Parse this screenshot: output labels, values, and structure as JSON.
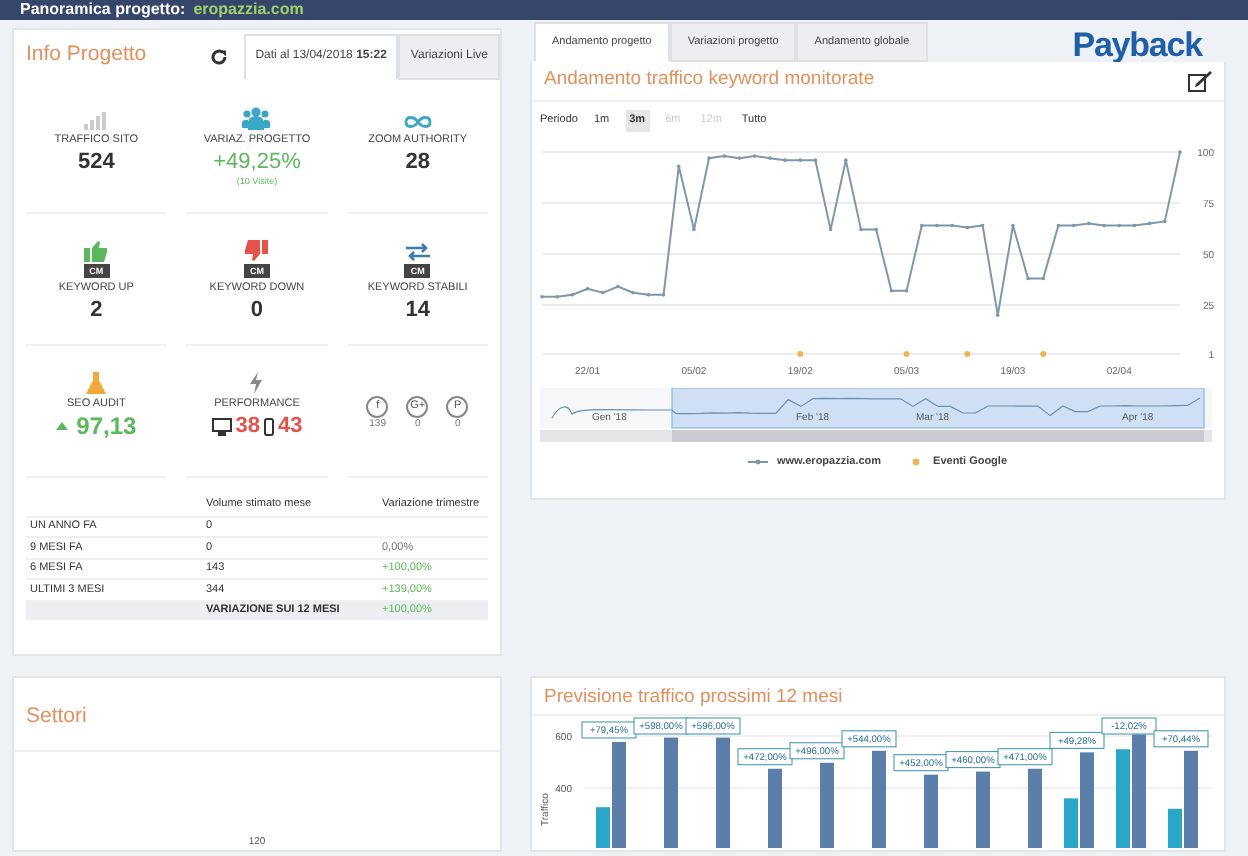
{
  "header": {
    "title": "Panoramica progetto:",
    "domain": "eropazzia.com"
  },
  "info_panel": {
    "title": "Info Progetto",
    "tabs": [
      {
        "label": "Dati al 13/04/2018 **15:22**",
        "selected": true
      },
      {
        "label": "Variazioni Live",
        "selected": false
      }
    ],
    "stats": [
      {
        "kind": "metric",
        "label": "TRAFFICO SITO",
        "value": "524"
      },
      {
        "kind": "metric",
        "label": "VARIAZ. PROGETTO",
        "value": "+49,25%",
        "note": "(10 Visite)",
        "positive": true
      },
      {
        "kind": "metric",
        "label": "ZOOM AUTHORITY",
        "value": "28"
      },
      {
        "kind": "metric",
        "badge": "CM",
        "label": "KEYWORD UP",
        "value": "2"
      },
      {
        "kind": "metric",
        "badge": "CM",
        "label": "KEYWORD DOWN",
        "value": "0"
      },
      {
        "kind": "metric",
        "badge": "CM",
        "label": "KEYWORD STABILI",
        "value": "14"
      },
      {
        "kind": "score",
        "label": "SEO AUDIT",
        "value": "97,13",
        "positive": true
      },
      {
        "kind": "performance",
        "label": "PERFORMANCE",
        "desktop": "38",
        "mobile": "43",
        "negative": true
      },
      {
        "kind": "social",
        "items": [
          {
            "glyph": "f",
            "count": "139"
          },
          {
            "glyph": "G+",
            "count": "0"
          },
          {
            "glyph": "P",
            "count": "0"
          }
        ]
      }
    ],
    "table": {
      "columns": [
        "Volume stimato mese",
        "Variazione trimestre"
      ],
      "rows": [
        {
          "label": "UN ANNO FA",
          "volume": "0"
        },
        {
          "label": "9 MESI FA",
          "volume": "0",
          "change": "0,00%",
          "positive": false
        },
        {
          "label": "6 MESI FA",
          "volume": "143",
          "change": "+100,00%",
          "positive": true
        },
        {
          "label": "ULTIMI 3 MESI",
          "volume": "344",
          "change": "+139,00%",
          "positive": true
        }
      ],
      "footer": {
        "label": "VARIAZIONE SUI 12 MESI",
        "change": "+100,00%",
        "positive": true
      }
    }
  },
  "sectors_card": {
    "title": "Settori",
    "tick": "120"
  },
  "right": {
    "tabs": [
      {
        "label": "Andamento progetto",
        "selected": true
      },
      {
        "label": "Variazioni progetto",
        "selected": false
      },
      {
        "label": "Andamento globale",
        "selected": false
      }
    ],
    "logo": "Payback",
    "traffic_card": {
      "title": "Andamento traffico keyword monitorate",
      "period_label": "Periodo",
      "periods": [
        {
          "label": "1m",
          "selected": false,
          "disabled": false
        },
        {
          "label": "3m",
          "selected": true,
          "disabled": false
        },
        {
          "label": "6m",
          "selected": false,
          "disabled": true
        },
        {
          "label": "12m",
          "selected": false,
          "disabled": true
        },
        {
          "label": "Tutto",
          "selected": false,
          "disabled": false
        }
      ],
      "chart_data": {
        "type": "line",
        "categories": [
          null,
          null,
          null,
          "22/01",
          null,
          null,
          null,
          null,
          null,
          null,
          "05/02",
          null,
          null,
          null,
          null,
          null,
          null,
          "19/02",
          null,
          null,
          null,
          null,
          null,
          null,
          "05/03",
          null,
          null,
          null,
          null,
          null,
          null,
          "19/03",
          null,
          null,
          null,
          null,
          null,
          null,
          "02/04",
          null,
          null,
          null,
          null
        ],
        "ylim": [
          1,
          100
        ],
        "yticks": [
          1,
          25,
          50,
          75,
          100
        ],
        "grid": true,
        "series": [
          {
            "name": "www.eropazzia.com",
            "color": "#7f97ab",
            "values": [
              29,
              29,
              30,
              33,
              31,
              34,
              31,
              30,
              30,
              93,
              62,
              97,
              98,
              97,
              98,
              97,
              96,
              96,
              96,
              62,
              96,
              62,
              62,
              32,
              32,
              64,
              64,
              64,
              63,
              64,
              20,
              64,
              38,
              38,
              64,
              64,
              65,
              64,
              64,
              64,
              65,
              66,
              100
            ]
          },
          {
            "name": "Eventi Google",
            "type": "scatter",
            "color": "#f0b454",
            "values": [
              null,
              null,
              null,
              null,
              null,
              null,
              null,
              null,
              null,
              null,
              null,
              null,
              null,
              null,
              null,
              null,
              null,
              1,
              null,
              null,
              null,
              null,
              null,
              null,
              1,
              null,
              null,
              null,
              1,
              null,
              null,
              null,
              null,
              1,
              null,
              null,
              null,
              null,
              null,
              null,
              null,
              null,
              null
            ]
          }
        ]
      },
      "navigator": {
        "labels": [
          "Gen '18",
          "Feb '18",
          "Mar '18",
          "Apr '18"
        ]
      }
    },
    "forecast_card": {
      "title": "Previsione traffico prossimi 12 mesi",
      "chart_data": {
        "type": "bar",
        "ylabel": "Traffico",
        "ylim": [
          169,
          677
        ],
        "yticks": [
          400,
          600
        ],
        "grid": true,
        "series": [
          {
            "color": "#2aa6c9",
            "values": [
              326,
              null,
              null,
              null,
              null,
              null,
              null,
              null,
              null,
              360,
              549,
              320
            ]
          },
          {
            "color": "#5b7fa8",
            "values": [
              577,
              594,
              594,
              474,
              497,
              543,
              451,
              463,
              474,
              537,
              606,
              543
            ]
          }
        ],
        "value_labels": [
          "+79,45%",
          "+598,00%",
          "+596,00%",
          "+472,00%",
          "+496,00%",
          "+544,00%",
          "+452,00%",
          "+460,00%",
          "+471,00%",
          "+49,28%",
          "-12,02%",
          "+70,44%"
        ]
      }
    }
  }
}
